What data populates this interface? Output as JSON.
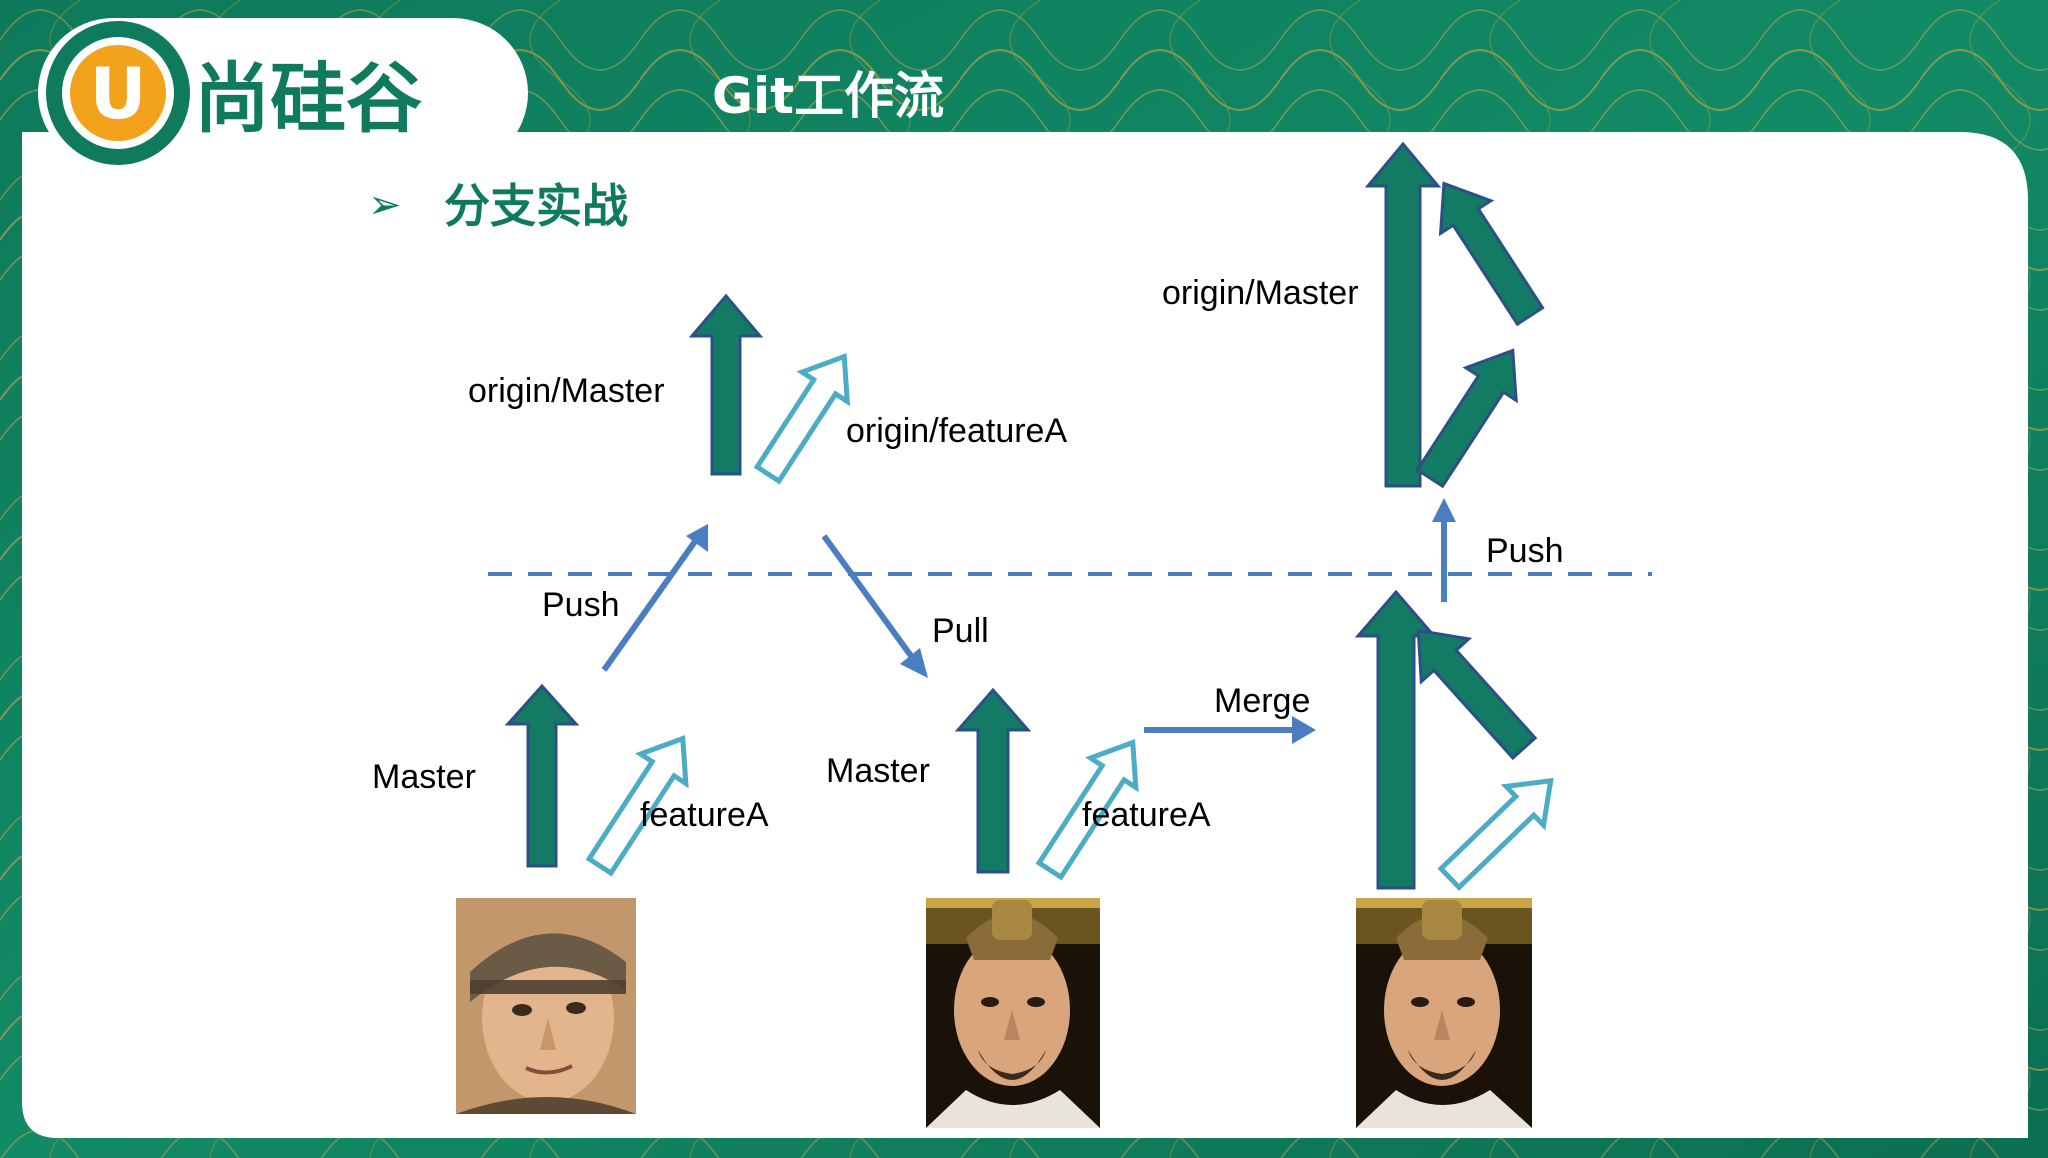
{
  "slide": {
    "title": "Git工作流",
    "brand_name": "尚硅谷",
    "logo_letter": "U",
    "bullet": "➢",
    "heading": "分支实战"
  },
  "colors": {
    "frame_green": "#0f7a5c",
    "frame_accent": "#f2a31b",
    "branch_master": "#137a63",
    "branch_master_outline": "#2b4f86",
    "branch_feature_outline": "#4bacc6",
    "flow_arrow": "#4a7ec0",
    "divider": "#4a7ec0"
  },
  "diagram": {
    "labels": {
      "origin_master_top": "origin/Master",
      "origin_feature": "origin/featureA",
      "push_left": "Push",
      "pull": "Pull",
      "master_left": "Master",
      "feature_left": "featureA",
      "master_mid": "Master",
      "feature_mid": "featureA",
      "merge": "Merge",
      "origin_master_right": "origin/Master",
      "push_right": "Push"
    },
    "portraits": [
      {
        "name": "developer-portrait"
      },
      {
        "name": "lead-portrait"
      },
      {
        "name": "lead-portrait"
      }
    ]
  }
}
